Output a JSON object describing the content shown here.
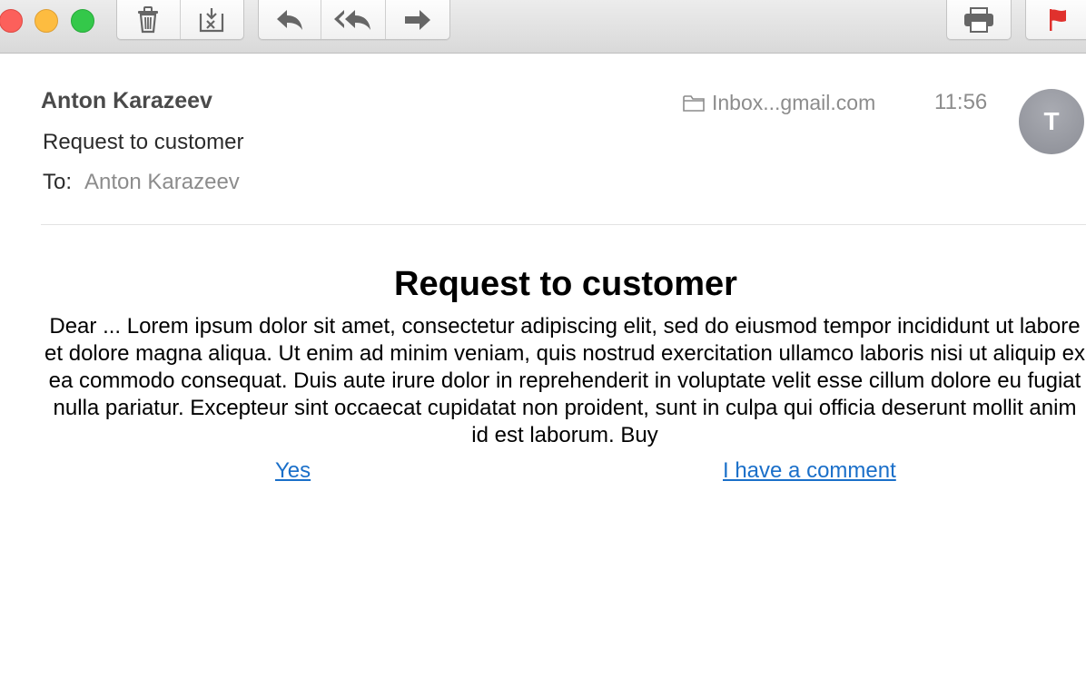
{
  "toolbar": {
    "buttons": [
      {
        "name": "trash-icon"
      },
      {
        "name": "junk-icon"
      },
      {
        "name": "reply-icon"
      },
      {
        "name": "reply-all-icon"
      },
      {
        "name": "forward-icon"
      },
      {
        "name": "print-icon"
      },
      {
        "name": "flag-icon"
      }
    ],
    "flag_color": "#e0312d"
  },
  "message": {
    "sender": "Anton Karazeev",
    "subject": "Request to customer",
    "to_label": "To:",
    "to_value": "Anton Karazeev",
    "mailbox": "Inbox...gmail.com",
    "time": "11:56",
    "avatar_initial": "T"
  },
  "body": {
    "title": "Request to customer",
    "text": "Dear ... Lorem ipsum dolor sit amet, consectetur adipiscing elit, sed do eiusmod tempor incididunt ut labore et dolore magna aliqua. Ut enim ad minim veniam, quis nostrud exercitation ullamco laboris nisi ut aliquip ex ea commodo consequat. Duis aute irure dolor in reprehenderit in voluptate velit esse cillum dolore eu fugiat nulla pariatur. Excepteur sint occaecat cupidatat non proident, sunt in culpa qui officia deserunt mollit anim id est laborum. Buy",
    "link_yes": "Yes",
    "link_comment": "I have a comment"
  }
}
